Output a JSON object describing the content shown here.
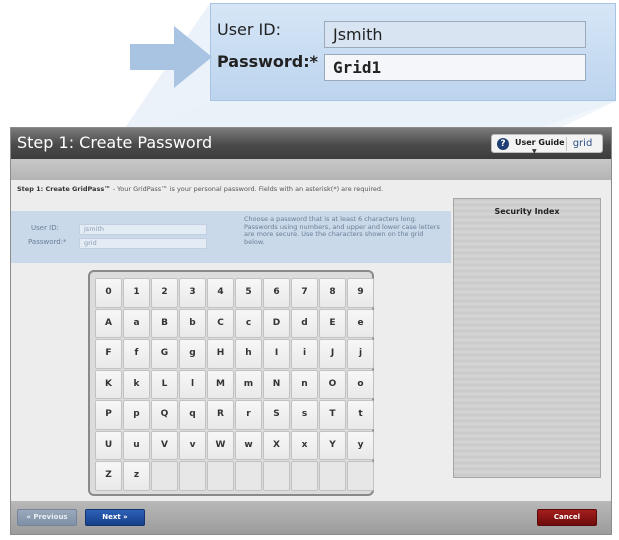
{
  "zoom": {
    "userid_label": "User ID:",
    "userid_value": "Jsmith",
    "password_label": "Password:*",
    "password_value": "Grid1"
  },
  "window": {
    "title": "Step 1: Create Password",
    "user_guide": {
      "label": "User Guide",
      "help_glyph": "?",
      "caret": "▼",
      "logo_text": "grid"
    }
  },
  "instruction": {
    "step": "Step 1: Create GridPass™",
    "text": " - Your GridPass™ is your personal password. Fields with an asterisk(*) are required."
  },
  "credentials": {
    "userid_label": "User ID:",
    "userid_value": "jsmith",
    "password_label": "Password:*",
    "password_value": "grid",
    "help_text": "Choose a password that is at least 6 characters long. Passwords using numbers, and upper and lower case letters are more secure. Use the characters shown on the grid below."
  },
  "security_index": {
    "title": "Security Index"
  },
  "keyboard": {
    "rows": [
      [
        "0",
        "1",
        "2",
        "3",
        "4",
        "5",
        "6",
        "7",
        "8",
        "9"
      ],
      [
        "A",
        "a",
        "B",
        "b",
        "C",
        "c",
        "D",
        "d",
        "E",
        "e"
      ],
      [
        "F",
        "f",
        "G",
        "g",
        "H",
        "h",
        "I",
        "i",
        "J",
        "j"
      ],
      [
        "K",
        "k",
        "L",
        "l",
        "M",
        "m",
        "N",
        "n",
        "O",
        "o"
      ],
      [
        "P",
        "p",
        "Q",
        "q",
        "R",
        "r",
        "S",
        "s",
        "T",
        "t"
      ],
      [
        "U",
        "u",
        "V",
        "v",
        "W",
        "w",
        "X",
        "x",
        "Y",
        "y"
      ],
      [
        "Z",
        "z",
        "",
        "",
        "",
        "",
        "",
        "",
        "",
        ""
      ]
    ]
  },
  "footer": {
    "previous_label": "« Previous",
    "next_label": "Next »",
    "cancel_label": "Cancel"
  },
  "colors": {
    "titlebar": "#4a4a4a",
    "next_button": "#1f4f9f",
    "cancel_button": "#8a1414",
    "callout_blue": "#c8dcf2"
  },
  "icons": [
    "right-arrow-icon",
    "help-icon",
    "grid-logo-icon"
  ]
}
